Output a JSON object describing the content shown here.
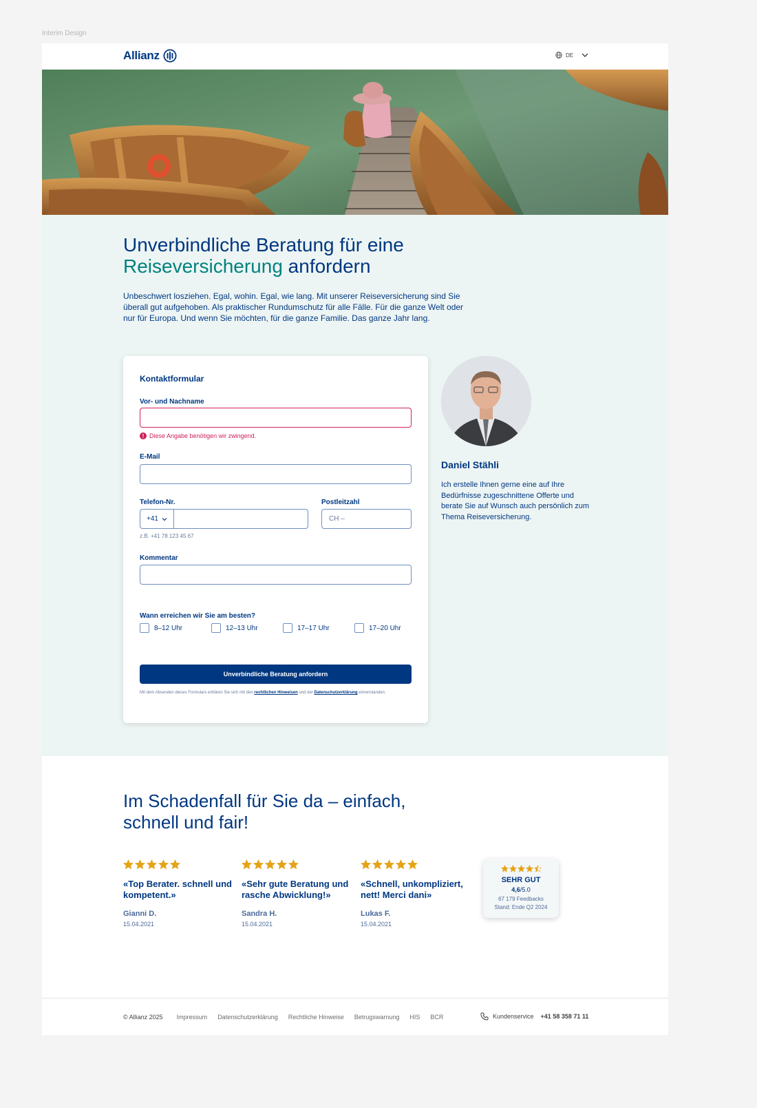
{
  "interim_label": "Interim Design",
  "header": {
    "brand": "Allianz",
    "language": "DE"
  },
  "hero": {
    "image_alt": "Person mit Hut sitzt auf einem Holzsteg zwischen Ruderbooten am See"
  },
  "intro": {
    "title_part1": "Unverbindliche Beratung für eine",
    "title_accent": "Reiseversicherung",
    "title_part2": "anfordern",
    "text": "Unbeschwert losziehen. Egal, wohin. Egal, wie lang. Mit unserer Reiseversicherung sind Sie überall gut aufgehoben. Als praktischer Rundumschutz für alle Fälle. Für die ganze Welt oder nur für Europa. Und wenn Sie möchten, für die ganze Familie. Das ganze Jahr lang."
  },
  "form": {
    "title": "Kontaktformular",
    "name_label": "Vor- und Nachname",
    "name_value": "",
    "name_error": "Diese Angabe benötigen wir zwingend.",
    "email_label": "E-Mail",
    "email_value": "",
    "phone_label": "Telefon-Nr.",
    "phone_prefix": "+41",
    "phone_value": "",
    "phone_hint": "z.B. +41 78 123 45 67",
    "postal_label": "Postleitzahl",
    "postal_value": "CH –",
    "comment_label": "Kommentar",
    "comment_value": "",
    "time_label": "Wann erreichen wir Sie am besten?",
    "time_options": [
      "8–12 Uhr",
      "12–13 Uhr",
      "17–17 Uhr",
      "17–20 Uhr"
    ],
    "submit_label": "Unverbindliche Beratung anfordern",
    "legal_pre": "Mit dem Absenden dieses Formulars erklären Sie sich mit den",
    "legal_link1": "rechtlichen Hinweisen",
    "legal_mid": "und der",
    "legal_link2": "Datenschutzerklärung",
    "legal_post": "einverstanden."
  },
  "advisor": {
    "name": "Daniel Stähli",
    "text": "Ich erstelle Ihnen gerne eine auf Ihre Bedürfnisse zugeschnittene Offerte und berate Sie auf Wunsch auch persönlich zum Thema Reiseversicherung."
  },
  "reviews": {
    "title": "Im Schadenfall für Sie da – einfach, schnell und fair!",
    "items": [
      {
        "stars": 5,
        "quote": "«Top Berater. schnell und kompetent.»",
        "author": "Gianni D.",
        "date": "15.04.2021"
      },
      {
        "stars": 5,
        "quote": "«Sehr gute Beratung und rasche Abwicklung!»",
        "author": "Sandra H.",
        "date": "15.04.2021"
      },
      {
        "stars": 5,
        "quote": "«Schnell, unkompliziert, nett! Merci dani»",
        "author": "Lukas F.",
        "date": "15.04.2021"
      }
    ],
    "badge": {
      "stars": 4.5,
      "title": "SEHR GUT",
      "score": "4,6",
      "max": "/5.0",
      "feedbacks": "67 179 Feedbacks",
      "stand": "Stand: Ende Q2 2024"
    }
  },
  "footer": {
    "copyright": "© Allianz 2025",
    "links": [
      "Impressum",
      "Datenschutzerklärung",
      "Rechtliche Hinweise",
      "Betrugswarnung",
      "HIS",
      "BCR"
    ],
    "service_label": "Kundenservice",
    "service_phone": "+41 58 358 71 11"
  },
  "colors": {
    "brand": "#003781",
    "accent": "#00827d",
    "error": "#d0205a",
    "star": "#e5a318",
    "section_bg": "#edf5f4"
  }
}
